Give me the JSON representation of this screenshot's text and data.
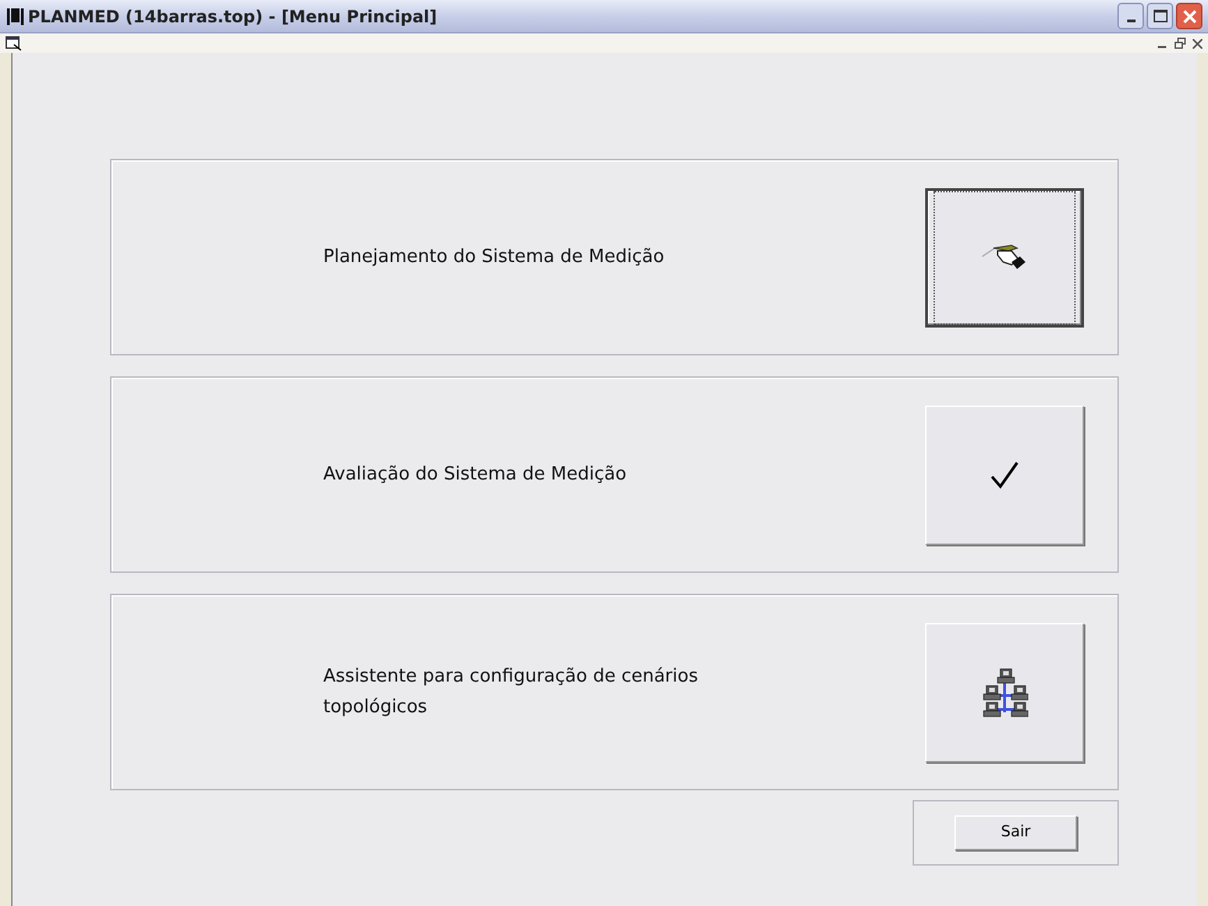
{
  "window": {
    "title": "PLANMED (14barras.top) - [Menu Principal]"
  },
  "options": [
    {
      "label": "Planejamento do Sistema de Medição",
      "kind": "pen",
      "focused": true
    },
    {
      "label": "Avaliação do Sistema de Medição",
      "kind": "check",
      "focused": false
    },
    {
      "label": "Assistente para configuração de cenários topológicos",
      "kind": "network",
      "focused": false
    }
  ],
  "exit_button": {
    "label": "Sair"
  }
}
